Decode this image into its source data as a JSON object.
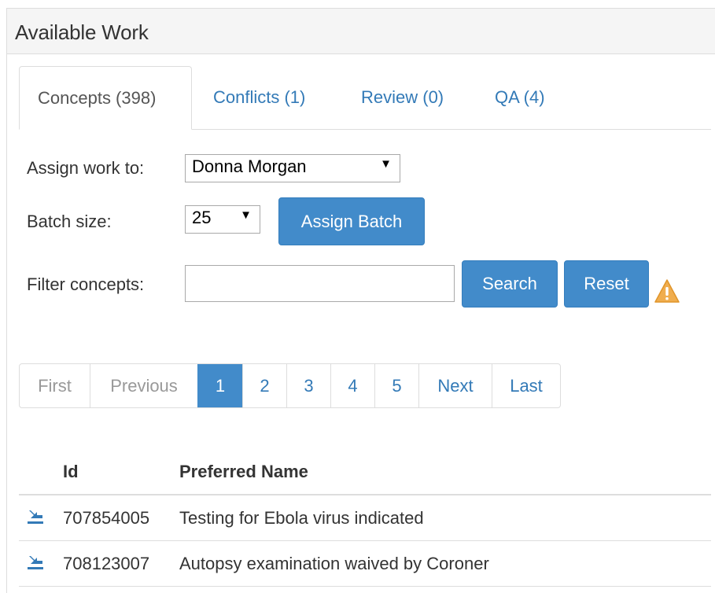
{
  "panel": {
    "title": "Available Work"
  },
  "tabs": [
    {
      "label": "Concepts (398)",
      "active": true
    },
    {
      "label": "Conflicts (1)",
      "active": false
    },
    {
      "label": "Review (0)",
      "active": false
    },
    {
      "label": "QA (4)",
      "active": false
    }
  ],
  "form": {
    "assign_label": "Assign work to:",
    "assign_value": "Donna Morgan",
    "batch_label": "Batch size:",
    "batch_value": "25",
    "assign_batch_button": "Assign Batch",
    "filter_label": "Filter concepts:",
    "filter_value": "",
    "search_button": "Search",
    "reset_button": "Reset",
    "warning_icon": "warning-triangle-icon",
    "arrow_glyph": "▼"
  },
  "pagination": {
    "first": "First",
    "previous": "Previous",
    "pages": [
      "1",
      "2",
      "3",
      "4",
      "5"
    ],
    "active_page": "1",
    "next": "Next",
    "last": "Last"
  },
  "table": {
    "columns": [
      "Id",
      "Preferred Name"
    ],
    "rows": [
      {
        "id": "707854005",
        "name": "Testing for Ebola virus indicated",
        "icon": "assign-to-me-icon"
      },
      {
        "id": "708123007",
        "name": "Autopsy examination waived by Coroner",
        "icon": "assign-to-me-icon"
      }
    ]
  },
  "colors": {
    "primary": "#428bca",
    "link": "#337ab7",
    "warning": "#f0ad4e",
    "border": "#dddddd",
    "heading_bg": "#f5f5f5"
  }
}
